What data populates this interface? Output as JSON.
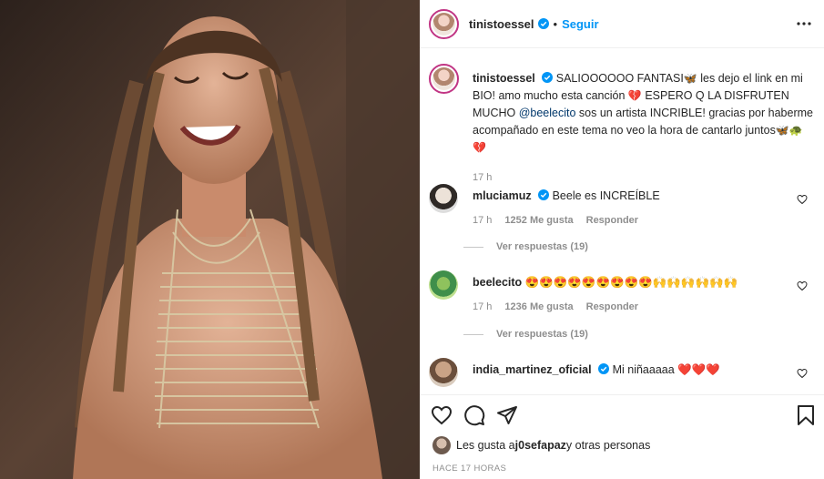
{
  "post": {
    "username": "tinistoessel",
    "follow_label": "Seguir",
    "separator": "•"
  },
  "caption": {
    "username": "tinistoessel",
    "part1": "SALIOOOOOO FANTASI",
    "part2": " les dejo el link en mi BIO! amo mucho esta canción ",
    "part3": " ESPERO Q LA DISFRUTEN MUCHO ",
    "mention": "@beelecito",
    "part4": " sos un artista INCRIBLE! gracias por haberme acompañado en este tema no veo la hora de cantarlo juntos",
    "emoji_butterfly": "🦋",
    "emoji_heart": "💔",
    "emoji_end": "🦋🐢",
    "emoji_last": "💔",
    "time": "17 h"
  },
  "comments": [
    {
      "username": "mluciamuz",
      "text": "Beele es INCREÍBLE",
      "time": "17 h",
      "likes": "1252 Me gusta",
      "reply": "Responder",
      "view_replies": "Ver respuestas (19)"
    },
    {
      "username": "beelecito",
      "text": "😍😍😍😍😍😍😍😍😍🙌🙌🙌🙌🙌🙌",
      "time": "17 h",
      "likes": "1236 Me gusta",
      "reply": "Responder",
      "view_replies": "Ver respuestas (19)"
    },
    {
      "username": "india_martinez_oficial",
      "text": "Mi niñaaaaa ❤️❤️❤️"
    }
  ],
  "footer": {
    "likes_prefix": "Les gusta a ",
    "likes_user": "j0sefapaz",
    "likes_suffix": " y otras personas",
    "ago": "HACE 17 HORAS"
  },
  "colors": {
    "accent": "#0095f6",
    "mention": "#00376b",
    "verified": "#0095f6",
    "heart": "#ed4956"
  },
  "icons": [
    "more-icon",
    "heart-icon",
    "comment-icon",
    "share-icon",
    "bookmark-icon",
    "verified-icon"
  ]
}
